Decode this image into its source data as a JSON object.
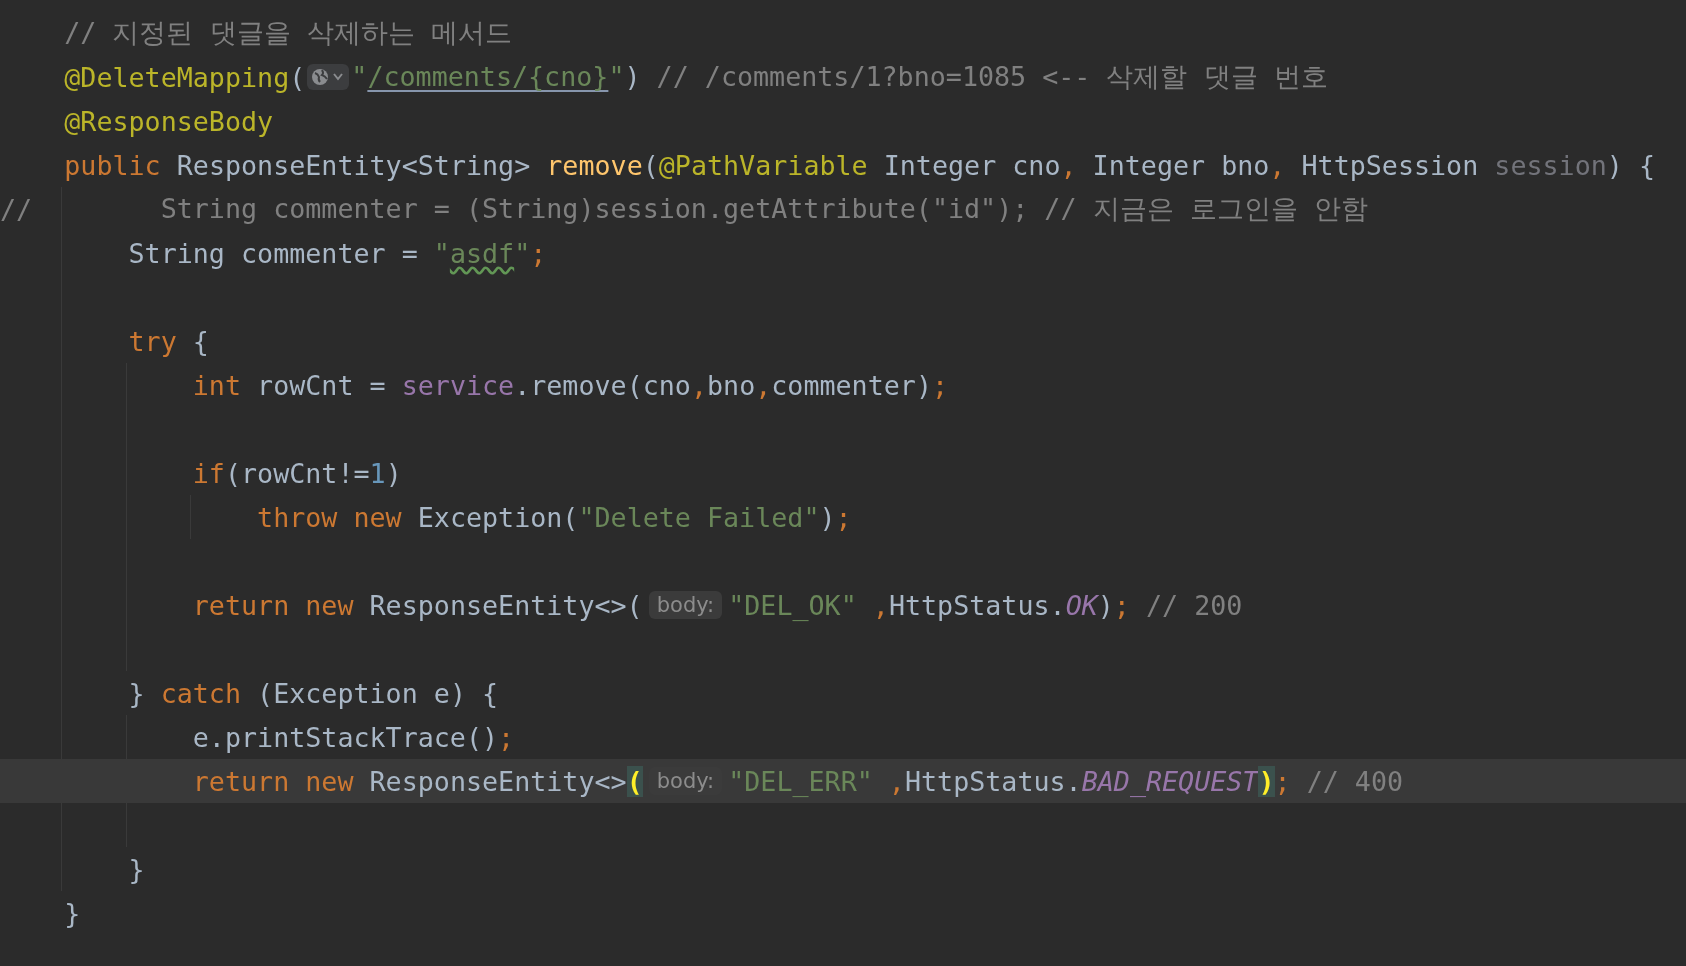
{
  "editor": {
    "lines": [
      {
        "kind": "code",
        "current": false,
        "tokens": [
          {
            "text": "// 지정된 댓글을 삭제하는 메서드",
            "kind": "comment"
          }
        ]
      },
      {
        "kind": "code",
        "current": false,
        "tokens": [
          {
            "text": "@DeleteMapping",
            "kind": "annotation"
          },
          {
            "text": "(",
            "kind": "plain"
          },
          {
            "kind": "url-menu"
          },
          {
            "text": "\"",
            "kind": "string"
          },
          {
            "text": "/comments/{cno}",
            "kind": "url"
          },
          {
            "text": "\"",
            "kind": "string"
          },
          {
            "text": ") ",
            "kind": "plain"
          },
          {
            "text": "// /comments/1?bno=1085 <-- 삭제할 댓글 번호",
            "kind": "comment"
          }
        ]
      },
      {
        "kind": "code",
        "current": false,
        "tokens": [
          {
            "text": "@ResponseBody",
            "kind": "annotation"
          }
        ]
      },
      {
        "kind": "code",
        "current": false,
        "tokens": [
          {
            "text": "public ",
            "kind": "keyword"
          },
          {
            "text": "ResponseEntity<String> ",
            "kind": "plain"
          },
          {
            "text": "remove",
            "kind": "method-decl"
          },
          {
            "text": "(",
            "kind": "plain"
          },
          {
            "text": "@PathVariable",
            "kind": "annotation"
          },
          {
            "text": " Integer cno",
            "kind": "plain"
          },
          {
            "text": ", ",
            "kind": "punct"
          },
          {
            "text": "Integer bno",
            "kind": "plain"
          },
          {
            "text": ", ",
            "kind": "punct"
          },
          {
            "text": "HttpSession ",
            "kind": "plain"
          },
          {
            "text": "session",
            "kind": "unused"
          },
          {
            "text": ") {",
            "kind": "plain"
          }
        ],
        "children": [
          {
            "kind": "commented",
            "current": false,
            "prefix": "//",
            "tokens": [
              {
                "text": "String commenter = (String)session.getAttribute(\"id\"); // 지금은 로그인을 안함",
                "kind": "comment"
              }
            ]
          },
          {
            "kind": "code",
            "current": false,
            "tokens": [
              {
                "text": "String commenter = ",
                "kind": "plain"
              },
              {
                "text": "\"",
                "kind": "string"
              },
              {
                "text": "asdf",
                "kind": "string-typo"
              },
              {
                "text": "\"",
                "kind": "string"
              },
              {
                "text": ";",
                "kind": "punct"
              }
            ]
          },
          {
            "kind": "blank",
            "current": false
          },
          {
            "kind": "code",
            "current": false,
            "tokens": [
              {
                "text": "try",
                "kind": "keyword"
              },
              {
                "text": " {",
                "kind": "plain"
              }
            ],
            "children": [
              {
                "kind": "code",
                "current": false,
                "tokens": [
                  {
                    "text": "int ",
                    "kind": "keyword"
                  },
                  {
                    "text": "rowCnt = ",
                    "kind": "plain"
                  },
                  {
                    "text": "service",
                    "kind": "field"
                  },
                  {
                    "text": ".remove(cno",
                    "kind": "plain"
                  },
                  {
                    "text": ",",
                    "kind": "punct"
                  },
                  {
                    "text": "bno",
                    "kind": "plain"
                  },
                  {
                    "text": ",",
                    "kind": "punct"
                  },
                  {
                    "text": "commenter)",
                    "kind": "plain"
                  },
                  {
                    "text": ";",
                    "kind": "punct"
                  }
                ]
              },
              {
                "kind": "blank",
                "current": false
              },
              {
                "kind": "code",
                "current": false,
                "tokens": [
                  {
                    "text": "if",
                    "kind": "keyword"
                  },
                  {
                    "text": "(rowCnt!=",
                    "kind": "plain"
                  },
                  {
                    "text": "1",
                    "kind": "number"
                  },
                  {
                    "text": ")",
                    "kind": "plain"
                  }
                ],
                "children": [
                  {
                    "kind": "code",
                    "current": false,
                    "tokens": [
                      {
                        "text": "throw new ",
                        "kind": "keyword"
                      },
                      {
                        "text": "Exception(",
                        "kind": "plain"
                      },
                      {
                        "text": "\"Delete Failed\"",
                        "kind": "string"
                      },
                      {
                        "text": ")",
                        "kind": "plain"
                      },
                      {
                        "text": ";",
                        "kind": "punct"
                      }
                    ]
                  }
                ]
              },
              {
                "kind": "blank",
                "current": false
              },
              {
                "kind": "code",
                "current": false,
                "tokens": [
                  {
                    "text": "return new ",
                    "kind": "keyword"
                  },
                  {
                    "text": "ResponseEntity<>(",
                    "kind": "plain"
                  },
                  {
                    "text": "body:",
                    "kind": "hint"
                  },
                  {
                    "text": "\"DEL_OK\"",
                    "kind": "string"
                  },
                  {
                    "text": " ,",
                    "kind": "punct"
                  },
                  {
                    "text": "HttpStatus.",
                    "kind": "plain"
                  },
                  {
                    "text": "OK",
                    "kind": "constant"
                  },
                  {
                    "text": ")",
                    "kind": "plain"
                  },
                  {
                    "text": "; ",
                    "kind": "punct"
                  },
                  {
                    "text": "// 200",
                    "kind": "comment"
                  }
                ]
              },
              {
                "kind": "blank",
                "current": false
              }
            ]
          },
          {
            "kind": "code",
            "current": false,
            "tokens": [
              {
                "text": "} ",
                "kind": "plain"
              },
              {
                "text": "catch",
                "kind": "keyword"
              },
              {
                "text": " (Exception e) {",
                "kind": "plain"
              }
            ],
            "children": [
              {
                "kind": "code",
                "current": false,
                "tokens": [
                  {
                    "text": "e.printStackTrace()",
                    "kind": "plain"
                  },
                  {
                    "text": ";",
                    "kind": "punct"
                  }
                ]
              },
              {
                "kind": "code",
                "current": true,
                "tokens": [
                  {
                    "text": "return new ",
                    "kind": "keyword"
                  },
                  {
                    "text": "ResponseEntity<>",
                    "kind": "plain"
                  },
                  {
                    "text": "(",
                    "kind": "brace-match"
                  },
                  {
                    "text": "body:",
                    "kind": "hint"
                  },
                  {
                    "text": "\"DEL_ERR\"",
                    "kind": "string"
                  },
                  {
                    "text": " ,",
                    "kind": "punct"
                  },
                  {
                    "text": "HttpStatus.",
                    "kind": "plain"
                  },
                  {
                    "text": "BAD_REQUEST",
                    "kind": "constant"
                  },
                  {
                    "text": ")",
                    "kind": "brace-match"
                  },
                  {
                    "text": "; ",
                    "kind": "punct"
                  },
                  {
                    "text": "// 400",
                    "kind": "comment"
                  }
                ]
              },
              {
                "kind": "blank",
                "current": false
              }
            ]
          },
          {
            "kind": "code",
            "current": false,
            "tokens": [
              {
                "text": "}",
                "kind": "plain"
              }
            ]
          }
        ]
      },
      {
        "kind": "code",
        "current": false,
        "tokens": [
          {
            "text": "}",
            "kind": "plain"
          }
        ]
      }
    ]
  }
}
